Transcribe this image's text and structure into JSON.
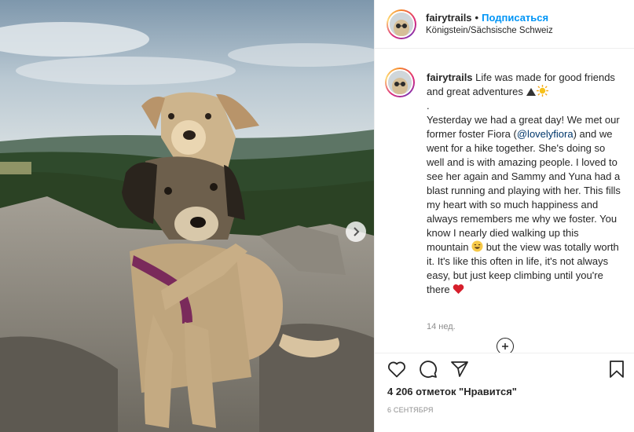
{
  "post": {
    "username": "fairytrails",
    "separator": "•",
    "follow_label": "Подписаться",
    "location": "Königstein/Sächsische Schweiz"
  },
  "caption": {
    "username": "fairytrails",
    "line_1": " Life was made for good friends and great adventures ",
    "dot_line": ".",
    "text_before_mention": "Yesterday we had a great day! We met our former foster Fiora (",
    "mention": "@lovelyfiora",
    "text_after_mention": ") and we went for a hike together. She's doing so well and is with amazing people. I loved to see her again and Sammy and Yuna had a blast running and playing with her. This fills my heart with so much happiness and always remembers me why we foster. You know I nearly died walking up this mountain ",
    "text_after_laugh": " but the view was totally worth it. It's like this often in life, it's not always easy, but just keep climbing until you're there ",
    "time": "14 нед."
  },
  "footer": {
    "likes": "4 206 отметок \"Нравится\"",
    "date": "6 СЕНТЯБРЯ"
  },
  "icons": {
    "like": "heart-outline-icon",
    "comment": "comment-bubble-icon",
    "share": "paper-plane-icon",
    "save": "bookmark-icon",
    "more": "plus-circle-icon",
    "next": "chevron-right-icon"
  },
  "colors": {
    "follow": "#0095f6",
    "mention": "#00376b",
    "heart": "#ed4956",
    "muted": "#8e8e8e"
  }
}
